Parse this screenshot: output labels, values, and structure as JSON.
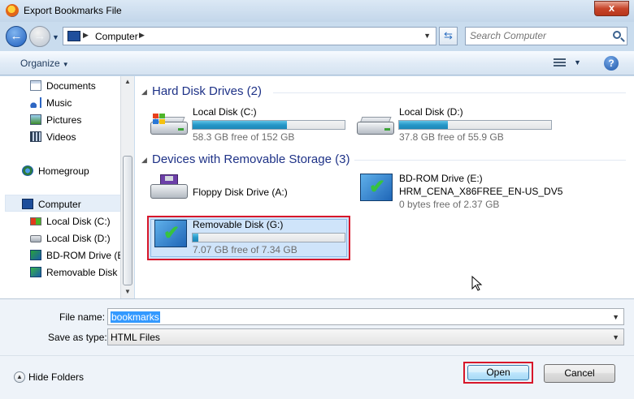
{
  "window": {
    "title": "Export Bookmarks File",
    "close_label": "x"
  },
  "address": {
    "crumb": "Computer",
    "search_placeholder": "Search Computer"
  },
  "toolbar": {
    "organize_label": "Organize"
  },
  "nav": {
    "items": [
      {
        "label": "Documents",
        "icon": "documents-icon"
      },
      {
        "label": "Music",
        "icon": "music-icon"
      },
      {
        "label": "Pictures",
        "icon": "pictures-icon"
      },
      {
        "label": "Videos",
        "icon": "videos-icon"
      },
      {
        "label": "Homegroup",
        "icon": "homegroup-icon"
      },
      {
        "label": "Computer",
        "icon": "computer-icon"
      },
      {
        "label": "Local Disk (C:)",
        "icon": "local-disk-icon"
      },
      {
        "label": "Local Disk (D:)",
        "icon": "local-disk-icon"
      },
      {
        "label": "BD-ROM Drive (E",
        "icon": "bd-rom-icon"
      },
      {
        "label": "Removable Disk (",
        "icon": "removable-disk-icon"
      }
    ]
  },
  "groups": {
    "hdd": {
      "title": "Hard Disk Drives (2)"
    },
    "removable": {
      "title": "Devices with Removable Storage (3)"
    }
  },
  "drives": {
    "c": {
      "name": "Local Disk (C:)",
      "free": "58.3 GB free of 152 GB",
      "used_fraction": 0.62
    },
    "d": {
      "name": "Local Disk (D:)",
      "free": "37.8 GB free of 55.9 GB",
      "used_fraction": 0.32
    },
    "a": {
      "name": "Floppy Disk Drive (A:)"
    },
    "e": {
      "name": "BD-ROM Drive (E:)",
      "label": "HRM_CENA_X86FREE_EN-US_DV5",
      "free": "0 bytes free of 2.37 GB"
    },
    "g": {
      "name": "Removable Disk (G:)",
      "free": "7.07 GB free of 7.34 GB",
      "used_fraction": 0.04
    }
  },
  "form": {
    "filename_label": "File name:",
    "filename_value": "bookmarks",
    "savetype_label": "Save as type:",
    "savetype_value": "HTML Files"
  },
  "footer": {
    "hide_folders_label": "Hide Folders",
    "open_label": "Open",
    "cancel_label": "Cancel"
  },
  "colors": {
    "highlight": "#d7162a",
    "bar_fill": "#2697c8",
    "group_header": "#1e3287"
  }
}
